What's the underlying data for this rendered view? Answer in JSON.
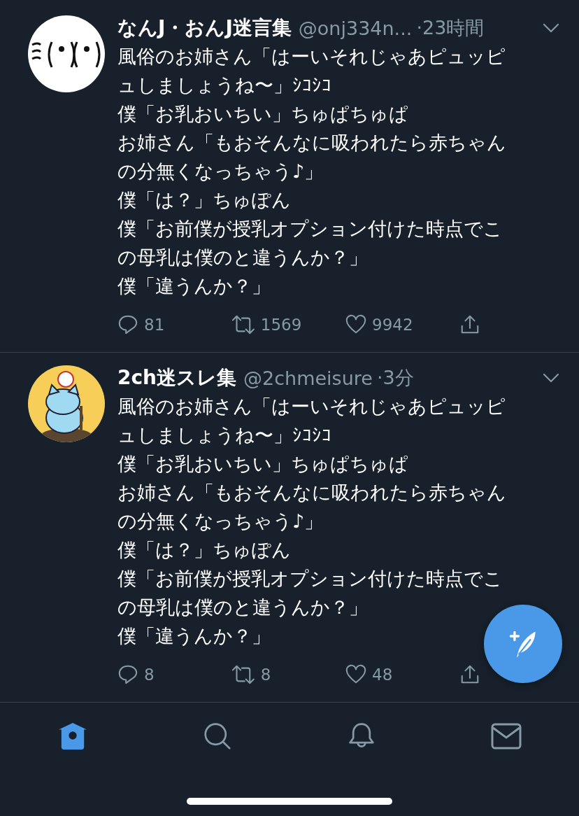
{
  "tweets": [
    {
      "name": "なんJ・おんJ迷言集",
      "handle": "@onj334n...",
      "time": "·23時間",
      "lines": [
        "風俗のお姉さん「はーいそれじゃあピュッピ",
        "ュしましょうね〜」ｼｺｼｺ",
        "僕「お乳おいちい」ちゅぱちゅぱ",
        "お姉さん「もおそんなに吸われたら赤ちゃん",
        "の分無くなっちゃう♪」",
        "僕「は？」ちゅぽん",
        "僕「お前僕が授乳オプション付けた時点でこ",
        "の母乳は僕のと違うんか？」",
        "僕「違うんか？」"
      ],
      "replies": "81",
      "retweets": "1569",
      "likes": "9942"
    },
    {
      "name": "2ch迷スレ集",
      "handle": "@2chmeisure",
      "time": "·3分",
      "lines": [
        "風俗のお姉さん「はーいそれじゃあピュッピ",
        "ュしましょうね〜」ｼｺｼｺ",
        "僕「お乳おいちい」ちゅぱちゅぱ",
        "お姉さん「もおそんなに吸われたら赤ちゃん",
        "の分無くなっちゃう♪」",
        "僕「は？」ちゅぽん",
        "僕「お前僕が授乳オプション付けた時点でこ",
        "の母乳は僕のと違うんか？」",
        "僕「違うんか？」"
      ],
      "replies": "8",
      "retweets": "8",
      "likes": "48"
    }
  ],
  "tabs": [
    {
      "kind": "home",
      "selected": true
    },
    {
      "kind": "search",
      "selected": false
    },
    {
      "kind": "notifications",
      "selected": false
    },
    {
      "kind": "messages",
      "selected": false
    }
  ]
}
